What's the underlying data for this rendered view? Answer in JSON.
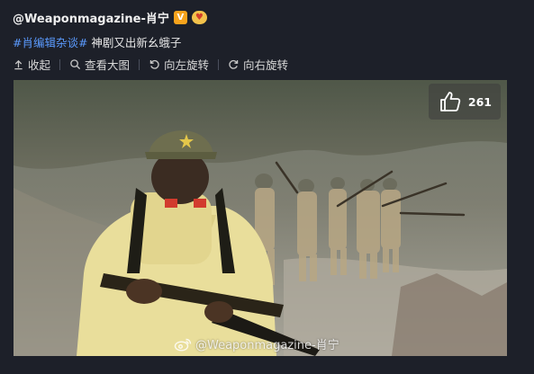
{
  "post": {
    "author": "@Weaponmagazine-肖宁",
    "verified_badge": "V",
    "hashtag": "#肖编辑杂谈#",
    "text": " 神剧又出新幺蛾子"
  },
  "actions": {
    "collapse": "收起",
    "view_large": "查看大图",
    "rotate_left": "向左旋转",
    "rotate_right": "向右旋转"
  },
  "image": {
    "like_count": "261",
    "watermark": "@Weaponmagazine-肖宁"
  },
  "colors": {
    "background": "#1d2029",
    "hashtag": "#5b9bff",
    "verified": "#f7a31c"
  }
}
